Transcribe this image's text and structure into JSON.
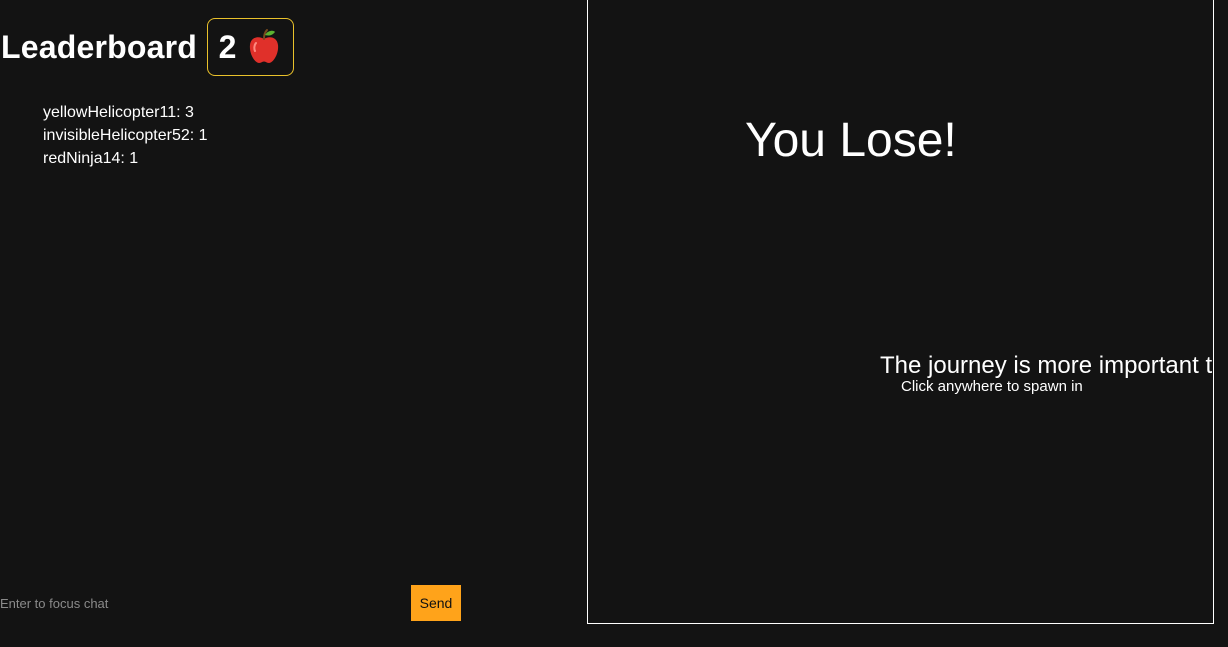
{
  "leaderboard": {
    "title": "Leaderboard",
    "score": "2",
    "score_icon": "apple-icon",
    "entries": [
      {
        "text": "yellowHelicopter11: 3"
      },
      {
        "text": "invisibleHelicopter52: 1"
      },
      {
        "text": "redNinja14: 1"
      }
    ]
  },
  "chat": {
    "placeholder": "Enter to focus chat",
    "send_label": "Send"
  },
  "game": {
    "status_text": "You Lose!",
    "quote_text": "The journey is more important than the destination",
    "spawn_hint": "Click anywhere to spawn in"
  },
  "colors": {
    "background": "#131313",
    "badge_border": "#e9c12b",
    "send_button": "#ffa31a",
    "canvas_border": "#ffffff"
  }
}
